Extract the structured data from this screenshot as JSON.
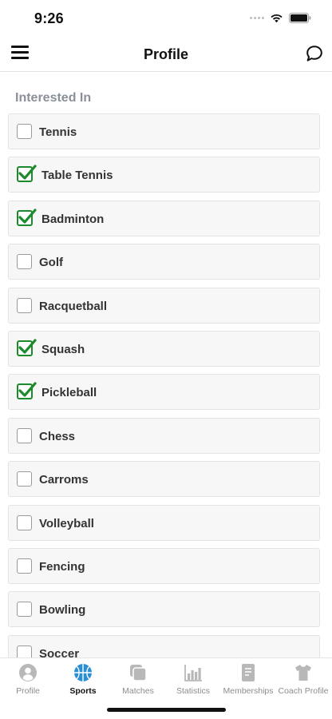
{
  "status_bar": {
    "time": "9:26"
  },
  "nav": {
    "title": "Profile"
  },
  "section": {
    "title": "Interested In"
  },
  "sports": [
    {
      "label": "Tennis",
      "checked": false
    },
    {
      "label": "Table Tennis",
      "checked": true
    },
    {
      "label": "Badminton",
      "checked": true
    },
    {
      "label": "Golf",
      "checked": false
    },
    {
      "label": "Racquetball",
      "checked": false
    },
    {
      "label": "Squash",
      "checked": true
    },
    {
      "label": "Pickleball",
      "checked": true
    },
    {
      "label": "Chess",
      "checked": false
    },
    {
      "label": "Carroms",
      "checked": false
    },
    {
      "label": "Volleyball",
      "checked": false
    },
    {
      "label": "Fencing",
      "checked": false
    },
    {
      "label": "Bowling",
      "checked": false
    },
    {
      "label": "Soccer",
      "checked": false
    }
  ],
  "tabs": [
    {
      "label": "Profile",
      "icon": "person-icon",
      "active": false
    },
    {
      "label": "Sports",
      "icon": "basketball-icon",
      "active": true
    },
    {
      "label": "Matches",
      "icon": "matches-icon",
      "active": false
    },
    {
      "label": "Statistics",
      "icon": "bar-chart-icon",
      "active": false
    },
    {
      "label": "Memberships",
      "icon": "document-icon",
      "active": false
    },
    {
      "label": "Coach Profile",
      "icon": "shirt-icon",
      "active": false
    }
  ],
  "colors": {
    "check": "#1a8a2a",
    "active_tab": "#2b8fd6",
    "inactive_tab": "#b8b8b8"
  }
}
